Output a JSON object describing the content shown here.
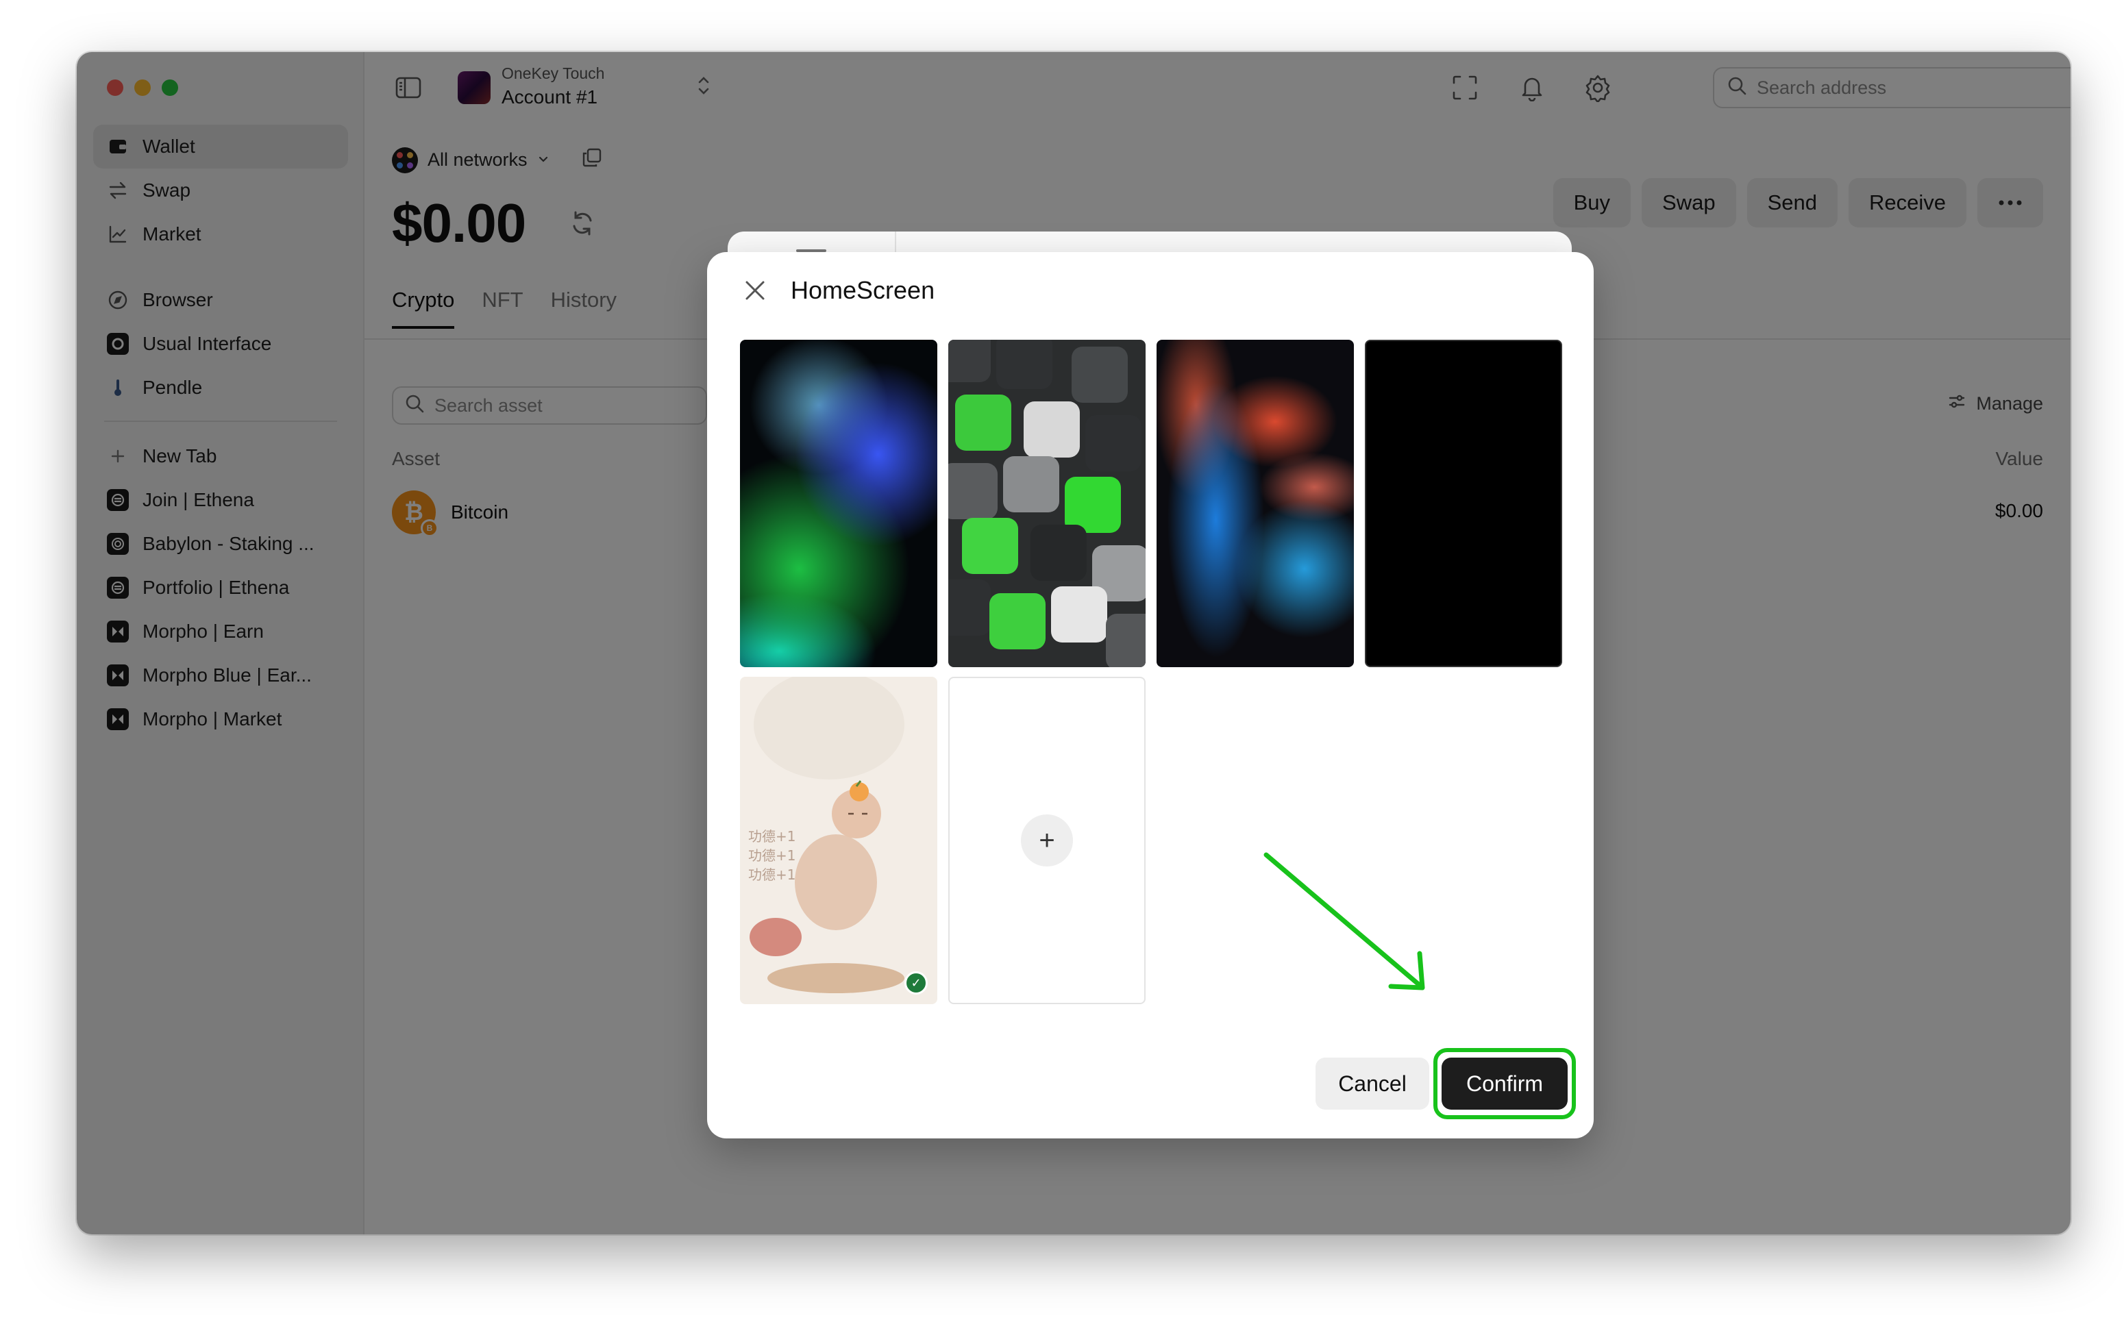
{
  "sidebar": {
    "items": [
      {
        "label": "Wallet",
        "icon": "wallet-icon",
        "active": true
      },
      {
        "label": "Swap",
        "icon": "swap-icon"
      },
      {
        "label": "Market",
        "icon": "market-chart-icon"
      }
    ],
    "bookmarks": [
      {
        "label": "Browser",
        "icon": "compass-icon"
      },
      {
        "label": "Usual Interface",
        "icon": "usual-logo-icon"
      },
      {
        "label": "Pendle",
        "icon": "pendle-logo-icon"
      }
    ],
    "tabs": [
      {
        "label": "New Tab",
        "icon": "plus-icon"
      },
      {
        "label": "Join | Ethena",
        "icon": "ethena-logo-icon"
      },
      {
        "label": "Babylon - Staking ...",
        "icon": "babylon-logo-icon"
      },
      {
        "label": "Portfolio | Ethena",
        "icon": "ethena-logo-icon"
      },
      {
        "label": "Morpho | Earn",
        "icon": "morpho-logo-icon"
      },
      {
        "label": "Morpho Blue | Ear...",
        "icon": "morpho-logo-icon"
      },
      {
        "label": "Morpho | Market",
        "icon": "morpho-logo-icon"
      }
    ]
  },
  "header": {
    "device": "OneKey Touch",
    "account": "Account #1",
    "search_placeholder": "Search address"
  },
  "main": {
    "network": "All networks",
    "balance": "$0.00",
    "actions": [
      "Buy",
      "Swap",
      "Send",
      "Receive"
    ],
    "tabs": [
      "Crypto",
      "NFT",
      "History"
    ],
    "search_placeholder": "Search asset",
    "manage_label": "Manage",
    "columns": {
      "asset": "Asset",
      "value": "Value"
    },
    "assets": [
      {
        "name": "Bitcoin",
        "value": "$0.00"
      }
    ]
  },
  "dialog": {
    "title": "HomeScreen",
    "wallpapers": [
      {
        "name": "green-blue-aurora",
        "selected": false
      },
      {
        "name": "green-cubes",
        "selected": false
      },
      {
        "name": "red-blue-fluid",
        "selected": false
      },
      {
        "name": "black",
        "selected": false
      },
      {
        "name": "bear-illustration",
        "selected": true
      }
    ],
    "add_glyph": "+",
    "cancel_label": "Cancel",
    "confirm_label": "Confirm"
  },
  "colors": {
    "accent_highlight": "#18c21b",
    "confirm_bg": "#1d1d1d",
    "selected_check": "#1e7a3a"
  }
}
